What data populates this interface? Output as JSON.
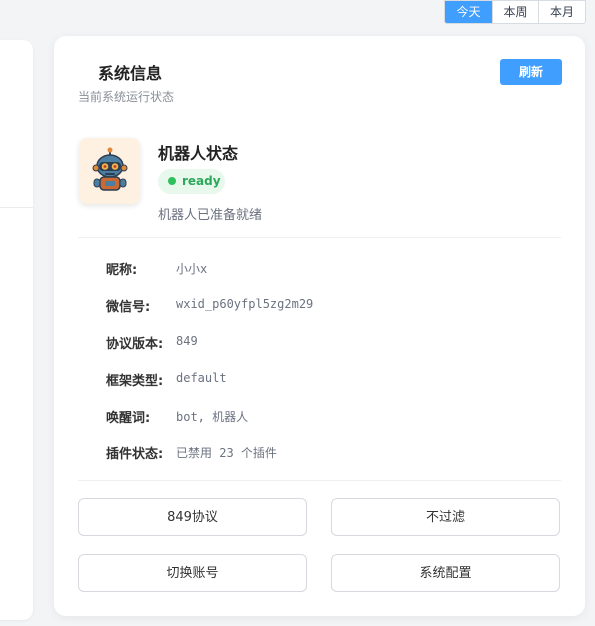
{
  "period_tabs": [
    {
      "label": "今天",
      "active": true
    },
    {
      "label": "本周",
      "active": false
    },
    {
      "label": "本月",
      "active": false
    }
  ],
  "card": {
    "title": "系统信息",
    "subtitle": "当前系统运行状态",
    "refresh_label": "刷新"
  },
  "bot": {
    "name": "机器人状态",
    "status": "ready",
    "status_desc": "机器人已准备就绪",
    "avatar_icon": "robot-avatar-icon"
  },
  "info": [
    {
      "label": "昵称:",
      "value": "小小x"
    },
    {
      "label": "微信号:",
      "value": "wxid_p60yfpl5zg2m29"
    },
    {
      "label": "协议版本:",
      "value": "849"
    },
    {
      "label": "框架类型:",
      "value": "default"
    },
    {
      "label": "唤醒词:",
      "value": "bot, 机器人"
    },
    {
      "label": "插件状态:",
      "value": "已禁用 23 个插件"
    }
  ],
  "actions": {
    "protocol": "849协议",
    "filter": "不过滤",
    "switch_account": "切换账号",
    "system_config": "系统配置"
  },
  "colors": {
    "primary": "#409eff",
    "ready_green": "#2fbf5b",
    "ready_bg": "#e8f8ec",
    "page_bg": "#f3f4f6"
  }
}
